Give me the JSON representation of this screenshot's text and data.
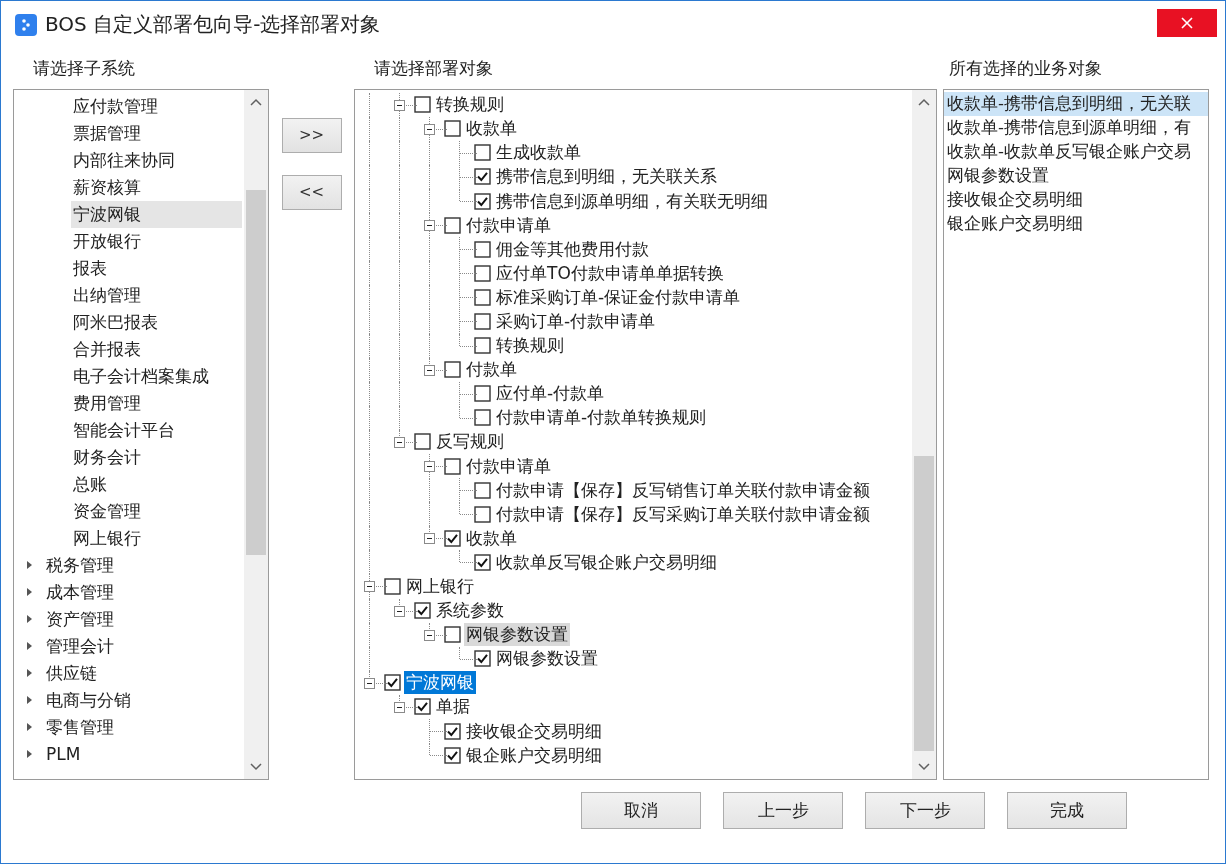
{
  "window": {
    "title": "BOS 自定义部署包向导-选择部署对象"
  },
  "subsystems": {
    "label": "请选择子系统",
    "continued_items": [
      {
        "label": "应付款管理",
        "selected": false
      },
      {
        "label": "票据管理",
        "selected": false
      },
      {
        "label": "内部往来协同",
        "selected": false
      },
      {
        "label": "薪资核算",
        "selected": false
      },
      {
        "label": "宁波网银",
        "selected": true
      },
      {
        "label": "开放银行",
        "selected": false
      },
      {
        "label": "报表",
        "selected": false
      },
      {
        "label": "出纳管理",
        "selected": false
      },
      {
        "label": "阿米巴报表",
        "selected": false
      },
      {
        "label": "合并报表",
        "selected": false
      },
      {
        "label": "电子会计档案集成",
        "selected": false
      },
      {
        "label": "费用管理",
        "selected": false
      },
      {
        "label": "智能会计平台",
        "selected": false
      },
      {
        "label": "财务会计",
        "selected": false
      },
      {
        "label": "总账",
        "selected": false
      },
      {
        "label": "资金管理",
        "selected": false
      },
      {
        "label": "网上银行",
        "selected": false
      }
    ],
    "items": [
      {
        "label": "税务管理",
        "selected": false,
        "expanded": false
      },
      {
        "label": "成本管理",
        "selected": false,
        "expanded": false
      },
      {
        "label": "资产管理",
        "selected": false,
        "expanded": false
      },
      {
        "label": "管理会计",
        "selected": false,
        "expanded": false
      },
      {
        "label": "供应链",
        "selected": false,
        "expanded": false
      },
      {
        "label": "电商与分销",
        "selected": false,
        "expanded": false
      },
      {
        "label": "零售管理",
        "selected": false,
        "expanded": false
      },
      {
        "label": "PLM",
        "selected": false,
        "expanded": false
      }
    ]
  },
  "move_buttons": [
    ">>",
    "<<"
  ],
  "objects": {
    "label": "请选择部署对象",
    "continued_items": [
      {
        "label": "转换规则",
        "checked": false,
        "expanded": true,
        "selected": false,
        "highlighted": false,
        "children": [
          {
            "label": "收款单",
            "checked": false,
            "expanded": true,
            "selected": false,
            "highlighted": false,
            "children": [
              {
                "label": "生成收款单",
                "checked": false,
                "selected": false,
                "highlighted": false
              },
              {
                "label": "携带信息到明细，无关联关系",
                "checked": true,
                "selected": false,
                "highlighted": false
              },
              {
                "label": "携带信息到源单明细，有关联无明细",
                "checked": true,
                "selected": false,
                "highlighted": false
              }
            ]
          },
          {
            "label": "付款申请单",
            "checked": false,
            "expanded": true,
            "selected": false,
            "highlighted": false,
            "children": [
              {
                "label": "佣金等其他费用付款",
                "checked": false,
                "selected": false,
                "highlighted": false
              },
              {
                "label": "应付单TO付款申请单单据转换",
                "checked": false,
                "selected": false,
                "highlighted": false
              },
              {
                "label": "标准采购订单-保证金付款申请单",
                "checked": false,
                "selected": false,
                "highlighted": false
              },
              {
                "label": "采购订单-付款申请单",
                "checked": false,
                "selected": false,
                "highlighted": false
              },
              {
                "label": "转换规则",
                "checked": false,
                "selected": false,
                "highlighted": false
              }
            ]
          },
          {
            "label": "付款单",
            "checked": false,
            "expanded": true,
            "selected": false,
            "highlighted": false,
            "children": [
              {
                "label": "应付单-付款单",
                "checked": false,
                "selected": false,
                "highlighted": false
              },
              {
                "label": "付款申请单-付款单转换规则",
                "checked": false,
                "selected": false,
                "highlighted": false
              }
            ]
          }
        ]
      },
      {
        "label": "反写规则",
        "checked": false,
        "expanded": true,
        "selected": false,
        "highlighted": false,
        "children": [
          {
            "label": "付款申请单",
            "checked": false,
            "expanded": true,
            "selected": false,
            "highlighted": false,
            "children": [
              {
                "label": "付款申请【保存】反写销售订单关联付款申请金额",
                "checked": false,
                "selected": false,
                "highlighted": false
              },
              {
                "label": "付款申请【保存】反写采购订单关联付款申请金额",
                "checked": false,
                "selected": false,
                "highlighted": false
              }
            ]
          },
          {
            "label": "收款单",
            "checked": true,
            "expanded": true,
            "selected": false,
            "highlighted": false,
            "children": [
              {
                "label": "收款单反写银企账户交易明细",
                "checked": true,
                "selected": false,
                "highlighted": false
              }
            ]
          }
        ]
      }
    ],
    "items": [
      {
        "label": "网上银行",
        "checked": false,
        "expanded": true,
        "selected": false,
        "highlighted": false,
        "children": [
          {
            "label": "系统参数",
            "checked": true,
            "expanded": true,
            "selected": false,
            "highlighted": false,
            "children": [
              {
                "label": "网银参数设置",
                "checked": false,
                "expanded": true,
                "selected": false,
                "highlighted": true,
                "children": [
                  {
                    "label": "网银参数设置",
                    "checked": true,
                    "selected": false,
                    "highlighted": false
                  }
                ]
              }
            ]
          }
        ]
      },
      {
        "label": "宁波网银",
        "checked": true,
        "expanded": true,
        "selected": true,
        "highlighted": false,
        "children": [
          {
            "label": "单据",
            "checked": true,
            "expanded": true,
            "selected": false,
            "highlighted": false,
            "children": [
              {
                "label": "接收银企交易明细",
                "checked": true,
                "selected": false,
                "highlighted": false
              },
              {
                "label": "银企账户交易明细",
                "checked": true,
                "selected": false,
                "highlighted": false
              }
            ]
          }
        ]
      }
    ]
  },
  "selected_objects": {
    "label": "所有选择的业务对象",
    "items": [
      {
        "label": "收款单-携带信息到明细，无关联",
        "selected": true
      },
      {
        "label": "收款单-携带信息到源单明细，有",
        "selected": false
      },
      {
        "label": "收款单-收款单反写银企账户交易",
        "selected": false
      },
      {
        "label": "网银参数设置",
        "selected": false
      },
      {
        "label": "接收银企交易明细",
        "selected": false
      },
      {
        "label": "银企账户交易明细",
        "selected": false
      }
    ]
  },
  "footer_buttons": [
    "取消",
    "上一步",
    "下一步",
    "完成"
  ]
}
